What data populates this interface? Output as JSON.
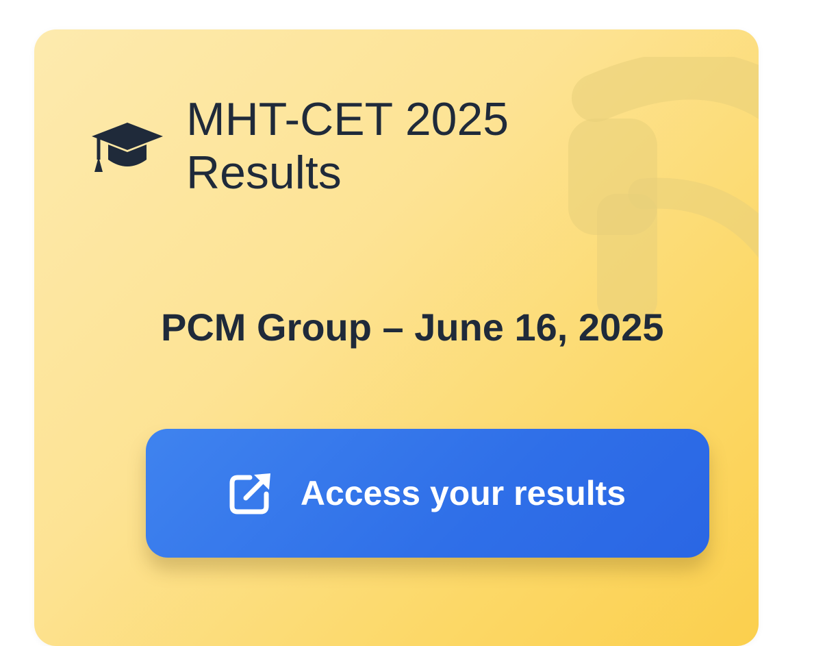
{
  "card": {
    "title": "MHT-CET 2025 Results",
    "title_icon": "graduation-cap-icon",
    "subtitle": "PCM Group – June 16, 2025",
    "watermark_icon": "faint-decorative-logo",
    "background_colors": [
      "#fdeaae",
      "#fbcf4d"
    ]
  },
  "cta": {
    "label": "Access your results",
    "icon": "external-link-icon",
    "color": "#2f6fe8"
  },
  "colors": {
    "text": "#1f2a3a"
  }
}
